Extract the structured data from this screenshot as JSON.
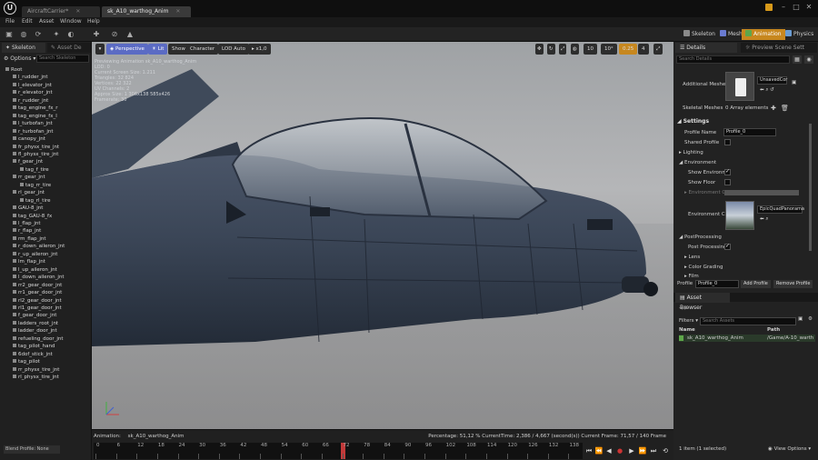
{
  "titlebar": {
    "logo": "U",
    "tabs": [
      "AircraftCarrier*",
      "sk_A10_warthog_Anim"
    ],
    "window_icons": [
      "minimize-icon",
      "maximize-icon",
      "close-icon"
    ]
  },
  "menu": [
    "File",
    "Edit",
    "Asset",
    "Window",
    "Help"
  ],
  "modes": [
    {
      "label": "Skeleton",
      "color": "#8a8a8a"
    },
    {
      "label": "Mesh",
      "color": "#6a7bd1"
    },
    {
      "label": "Animation",
      "color": "#5ea64a"
    },
    {
      "label": "Physics",
      "color": "#6a9bd1"
    }
  ],
  "left_panel": {
    "tabs": [
      "Skeleton",
      "Asset De"
    ],
    "options_label": "Options",
    "search_placeholder": "Search Skeleton",
    "bones": [
      {
        "name": "Root",
        "depth": 0
      },
      {
        "name": "l_rudder_jnt",
        "depth": 1
      },
      {
        "name": "l_elevator_jnt",
        "depth": 1
      },
      {
        "name": "r_elevator_jnt",
        "depth": 1
      },
      {
        "name": "r_rudder_jnt",
        "depth": 1
      },
      {
        "name": "tag_engine_fx_r",
        "depth": 1
      },
      {
        "name": "tag_engine_fx_l",
        "depth": 1
      },
      {
        "name": "l_turbofan_jnt",
        "depth": 1
      },
      {
        "name": "r_turbofan_jnt",
        "depth": 1
      },
      {
        "name": "canopy_jnt",
        "depth": 1
      },
      {
        "name": "fr_physx_tire_jnt",
        "depth": 1
      },
      {
        "name": "fl_physx_tire_jnt",
        "depth": 1
      },
      {
        "name": "f_gear_jnt",
        "depth": 1
      },
      {
        "name": "tag_f_tire",
        "depth": 2
      },
      {
        "name": "rr_gear_jnt",
        "depth": 1
      },
      {
        "name": "tag_rr_tire",
        "depth": 2
      },
      {
        "name": "rl_gear_jnt",
        "depth": 1
      },
      {
        "name": "tag_rl_tire",
        "depth": 2
      },
      {
        "name": "GAU-8_jnt",
        "depth": 1
      },
      {
        "name": "tag_GAU-8_fx",
        "depth": 1
      },
      {
        "name": "l_flap_jnt",
        "depth": 1
      },
      {
        "name": "r_flap_jnt",
        "depth": 1
      },
      {
        "name": "rm_flap_jnt",
        "depth": 1
      },
      {
        "name": "r_down_aileron_jnt",
        "depth": 1
      },
      {
        "name": "r_up_aileron_jnt",
        "depth": 1
      },
      {
        "name": "lm_flap_jnt",
        "depth": 1
      },
      {
        "name": "l_up_aileron_jnt",
        "depth": 1
      },
      {
        "name": "l_down_aileron_jnt",
        "depth": 1
      },
      {
        "name": "rr2_gear_door_jnt",
        "depth": 1
      },
      {
        "name": "rr1_gear_door_jnt",
        "depth": 1
      },
      {
        "name": "rl2_gear_door_jnt",
        "depth": 1
      },
      {
        "name": "rl1_gear_door_jnt",
        "depth": 1
      },
      {
        "name": "f_gear_door_jnt",
        "depth": 1
      },
      {
        "name": "ladders_root_jnt",
        "depth": 1
      },
      {
        "name": "ladder_door_jnt",
        "depth": 1
      },
      {
        "name": "refueling_door_jnt",
        "depth": 1
      },
      {
        "name": "tag_pilot_hand",
        "depth": 1
      },
      {
        "name": "6dof_stick_jnt",
        "depth": 1
      },
      {
        "name": "tag_pilot",
        "depth": 1
      },
      {
        "name": "rr_physx_tire_jnt",
        "depth": 1
      },
      {
        "name": "rl_physx_tire_jnt",
        "depth": 1
      }
    ],
    "blend_profile": "Blend Profile: None"
  },
  "viewport": {
    "buttons": [
      "Perspective",
      "Lit",
      "Show",
      "Character",
      "LOD Auto",
      "x1,0"
    ],
    "right_numbers": [
      "10",
      "10°",
      "0.25",
      "4"
    ],
    "stats": [
      "Previewing Animation sk_A10_warthog_Anim",
      "LOD: 0",
      "Current Screen Size: 1.211",
      "Triangles: 32 824",
      "Vertices: 22 322",
      "UV Channels: 2",
      "Approx Size: 1 306x138 585x426",
      "Framerate: 30"
    ]
  },
  "anim_bar": {
    "animation_label": "Animation:",
    "animation_name": "sk_A10_warthog_Anim",
    "status": "Percentage: 51,12 % CurrentTime: 2,386 / 4,667 (second(s)) Current Frame: 71,57 / 140 Frame",
    "ticks": [
      "0",
      "6",
      "12",
      "18",
      "24",
      "30",
      "36",
      "42",
      "48",
      "54",
      "60",
      "66",
      "72",
      "78",
      "84",
      "90",
      "96",
      "102",
      "108",
      "114",
      "120",
      "126",
      "132",
      "138"
    ],
    "playhead_frame": 71.57,
    "total_frames": 140,
    "controls": [
      "skip-start-icon",
      "step-back-icon",
      "play-reverse-icon",
      "record-icon",
      "play-icon",
      "step-forward-icon",
      "skip-end-icon",
      "loop-icon"
    ]
  },
  "right_panel": {
    "tabs": [
      "Details",
      "Preview Scene Sett"
    ],
    "search_placeholder": "Search Details",
    "additional_meshes_label": "Additional Meshes",
    "additional_meshes_value": "UnsavedCor",
    "skeletal_meshes_label": "Skeletal Meshes",
    "skeletal_meshes_value": "0 Array elements",
    "settings_header": "Settings",
    "profile_name_label": "Profile Name",
    "profile_name_value": "Profile_0",
    "shared_profile_label": "Shared Profile",
    "lighting_label": "Lighting",
    "environment_label": "Environment",
    "show_environment_label": "Show Environm",
    "show_floor_label": "Show Floor",
    "environment_color_label": "Environment Co",
    "environment_cubemap_label": "Environment Cu",
    "cubemap_value": "EpicQuadPanorama",
    "postprocessing_label": "PostProcessing",
    "postprocessing_enabled_label": "Post Processing",
    "lens_label": "Lens",
    "color_grading_label": "Color Grading",
    "film_label": "Film",
    "profile_label": "Profile",
    "profile_value": "Profile_0",
    "add_profile": "Add Profile",
    "remove_profile": "Remove Profile",
    "asset_browser_tab": "Asset Browser",
    "filters_label": "Filters",
    "search_assets_placeholder": "Search Assets",
    "col_name": "Name",
    "col_path": "Path",
    "asset_name": "sk_A10_warthog_Anim",
    "asset_path": "/Game/A-10_warth",
    "item_count": "1 item (1 selected)",
    "view_options": "View Options"
  }
}
